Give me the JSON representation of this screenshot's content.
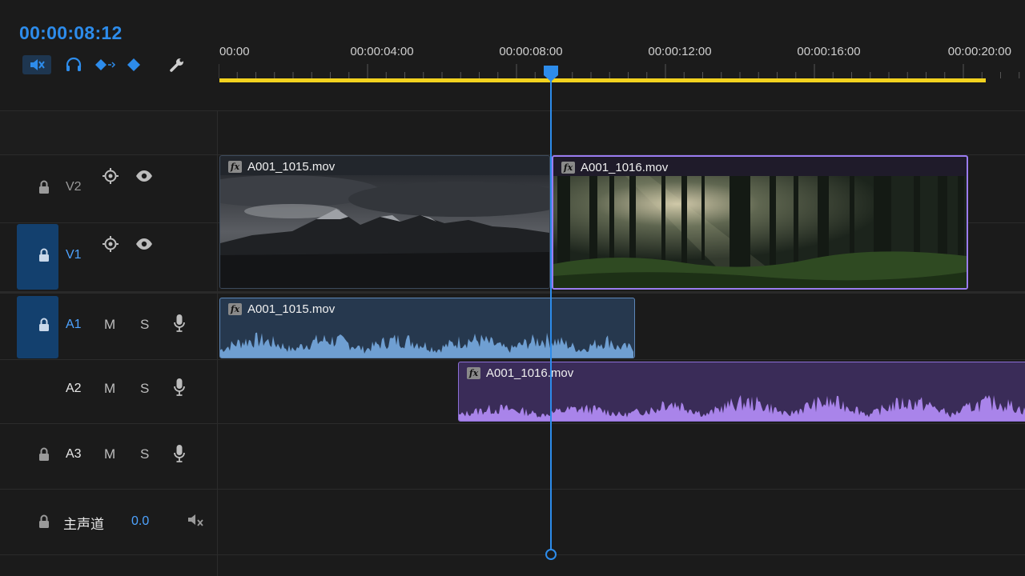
{
  "timecode": "00:00:08:12",
  "toolbar": {
    "icons": [
      "snap-speaker-muted-icon",
      "headphones-icon",
      "keyframe-nav-icon",
      "keyframe-icon",
      "wrench-icon"
    ],
    "accent": "#2d8ceb"
  },
  "ruler": {
    "labels": [
      "00:00",
      "00:00:04:00",
      "00:00:08:00",
      "00:00:12:00",
      "00:00:16:00",
      "00:00:20:00"
    ],
    "work_area_color": "#f2d21f"
  },
  "tracks": {
    "v2": {
      "name": "V2"
    },
    "v1": {
      "name": "V1"
    },
    "a1": {
      "name": "A1",
      "mute": "M",
      "solo": "S"
    },
    "a2": {
      "name": "A2",
      "mute": "M",
      "solo": "S"
    },
    "a3": {
      "name": "A3",
      "mute": "M",
      "solo": "S"
    },
    "master": {
      "name": "主声道",
      "value": "0.0"
    }
  },
  "clips": {
    "v1_a": {
      "name": "A001_1015.mov",
      "fx": "fx"
    },
    "v1_b": {
      "name": "A001_1016.mov",
      "fx": "fx"
    },
    "a1": {
      "name": "A001_1015.mov",
      "fx": "fx"
    },
    "a2": {
      "name": "A001_1016.mov",
      "fx": "fx"
    }
  },
  "colors": {
    "playhead": "#2d8ceb",
    "selected_clip": "#9a7cf0",
    "audio_a1": "#6f9fd2",
    "audio_a2": "#a984ea"
  }
}
